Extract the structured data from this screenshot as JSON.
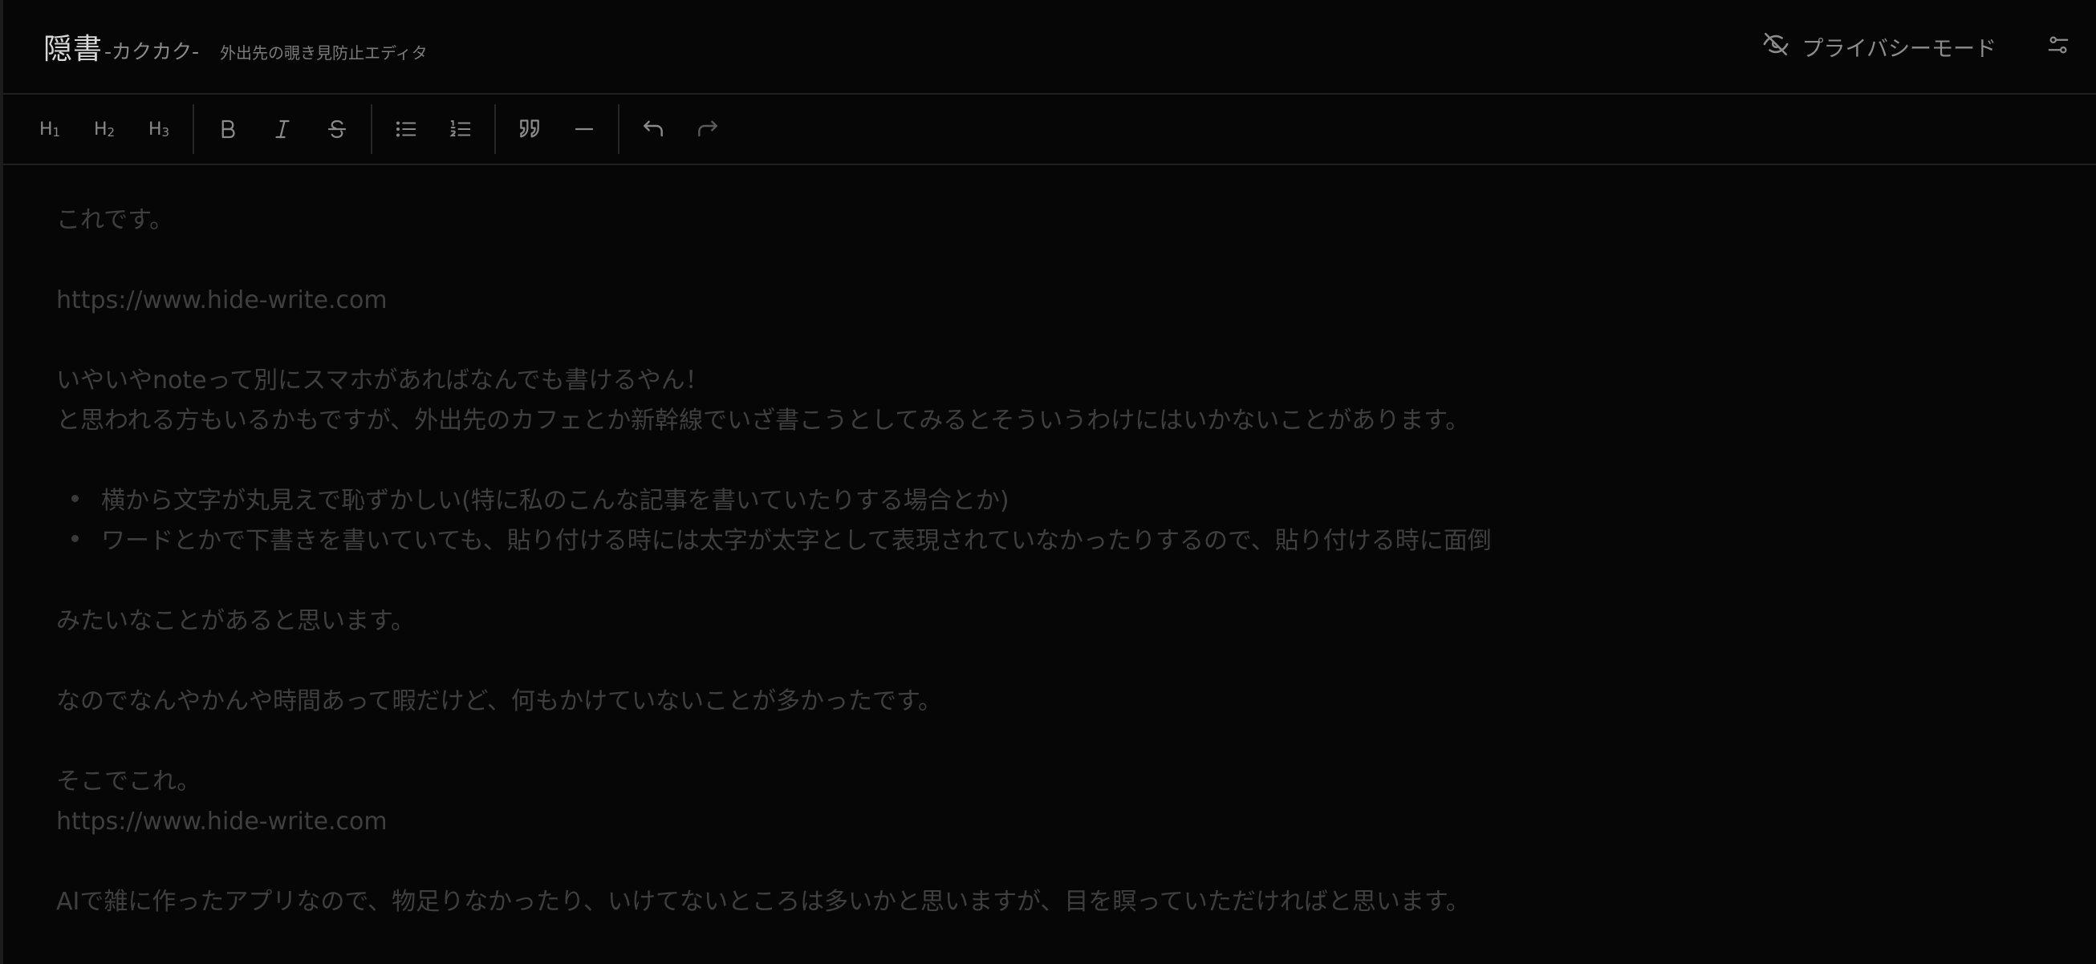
{
  "header": {
    "brand_main": "隠書",
    "brand_sub": "-カクカク-",
    "brand_tag": "外出先の覗き見防止エディタ",
    "privacy_label": "プライバシーモード"
  },
  "toolbar": {
    "h1": "H",
    "h1_sub": "1",
    "h2": "H",
    "h2_sub": "2",
    "h3": "H",
    "h3_sub": "3"
  },
  "editor": {
    "p1": "これです。",
    "p2": "https://www.hide-write.com",
    "p3a": "いやいやnoteって別にスマホがあればなんでも書けるやん！",
    "p3b": "と思われる方もいるかもですが、外出先のカフェとか新幹線でいざ書こうとしてみるとそういうわけにはいかないことがあります。",
    "bullets": [
      "横から文字が丸見えで恥ずかしい(特に私のこんな記事を書いていたりする場合とか)",
      "ワードとかで下書きを書いていても、貼り付ける時には太字が太字として表現されていなかったりするので、貼り付ける時に面倒"
    ],
    "p4": "みたいなことがあると思います。",
    "p5": "なのでなんやかんや時間あって暇だけど、何もかけていないことが多かったです。",
    "p6a": "そこでこれ。",
    "p6b": "https://www.hide-write.com",
    "p7": "AIで雑に作ったアプリなので、物足りなかったり、いけてないところは多いかと思いますが、目を瞑っていただければと思います。"
  },
  "colors": {
    "background": "#060606",
    "text_dim": "#3f3f3f",
    "icon": "#8a8a8a"
  }
}
